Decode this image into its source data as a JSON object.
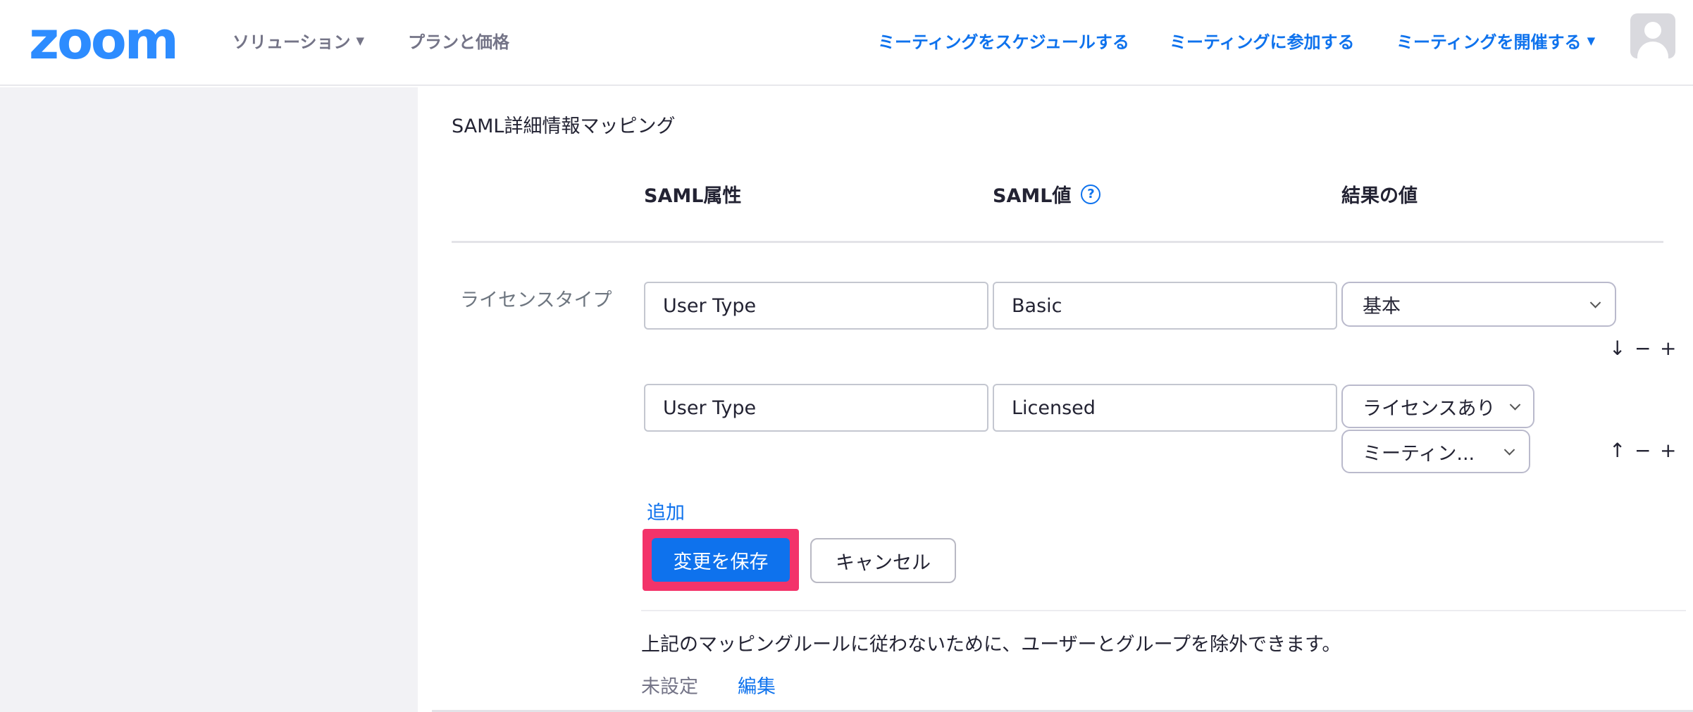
{
  "header": {
    "logo_text": "zoom",
    "nav_left": [
      {
        "label": "ソリューション",
        "has_caret": true
      },
      {
        "label": "プランと価格",
        "has_caret": false
      }
    ],
    "nav_right": [
      {
        "label": "ミーティングをスケジュールする",
        "has_caret": false
      },
      {
        "label": "ミーティングに参加する",
        "has_caret": false
      },
      {
        "label": "ミーティングを開催する",
        "has_caret": true
      }
    ],
    "avatar_icon": "user-avatar-icon"
  },
  "mapping": {
    "section_title": "SAML詳細情報マッピング",
    "col_attribute": "SAML属性",
    "col_value": "SAML値",
    "col_result": "結果の値",
    "help_glyph": "?",
    "row_label": "ライセンスタイプ",
    "rows": [
      {
        "attribute": "User Type",
        "value": "Basic",
        "result": "基本",
        "controls": {
          "arrow": "↓",
          "minus": "−",
          "plus": "+"
        }
      },
      {
        "attribute": "User Type",
        "value": "Licensed",
        "result": "ライセンスあり",
        "result_extra": "ミーティン...",
        "controls": {
          "arrow": "↑",
          "minus": "−",
          "plus": "+"
        }
      }
    ],
    "add_label": "追加",
    "save_label": "変更を保存",
    "cancel_label": "キャンセル"
  },
  "exclusion": {
    "note": "上記のマッピングルールに従わないために、ユーザーとグループを除外できます。",
    "status": "未設定",
    "edit_label": "編集"
  },
  "colors": {
    "brand_blue": "#2d8cff",
    "link_blue": "#0e72ed",
    "highlight_pink": "#f3336a"
  }
}
